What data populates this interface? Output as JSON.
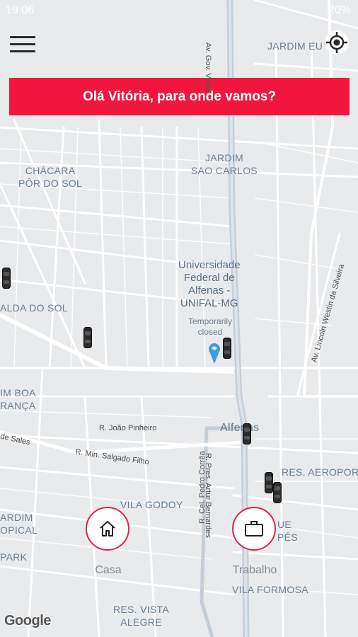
{
  "status": {
    "time": "19:06",
    "battery": "20%"
  },
  "banner": {
    "text": "Olá Vitória, para onde vamos?"
  },
  "icons": {
    "menu": "hamburger-icon",
    "locate": "my-location-icon",
    "home": "home-icon",
    "work": "briefcase-icon"
  },
  "shortcuts": {
    "home_label": "Casa",
    "work_label": "Trabalho"
  },
  "map": {
    "neighborhoods": {
      "jardim_eu": "JARDIM EU",
      "jardim_sao_carlos": "JARDIM\nSAO CARLOS",
      "chacara": "CHÁCARA\nPÔR DO SOL",
      "alda": "ALDA DO SOL",
      "jardim_boa": "IM BOA\nRANÇA",
      "ardim_opical": "ARDIM\nOPICAL",
      "park": "PARK",
      "vila_godoy": "VILA GODOY",
      "res_aeroport": "RES. AEROPORT",
      "ue_pes": "UE\nPÉS",
      "vila_formosa": "VILA FORMOSA",
      "res_vista": "RES. VISTA\nALEGRE",
      "alfenas": "Alfenas"
    },
    "poi": {
      "name": "Universidade\nFederal de\nAlfenas -\nUNIFAL-MG",
      "status": "Temporarily\nclosed"
    },
    "roads": {
      "gov_valad": "Av. Gov. Valad",
      "joao_pinheiro": "R. João Pinheiro",
      "de_sales": "de Sales",
      "salgado_filho": "R. Min. Salgado Filho",
      "pedro_correa": "R. Cel. Pedro Corrêa",
      "artur_bernardes": "R. Pres. Artur Bernardes",
      "lincoln": "Av. Lincoln Westin da Silveira"
    },
    "attribution": "Google"
  },
  "colors": {
    "accent": "#f0163e",
    "map_bg": "#e8eaec",
    "road": "#ffffff",
    "main_road": "#c5ced8"
  }
}
